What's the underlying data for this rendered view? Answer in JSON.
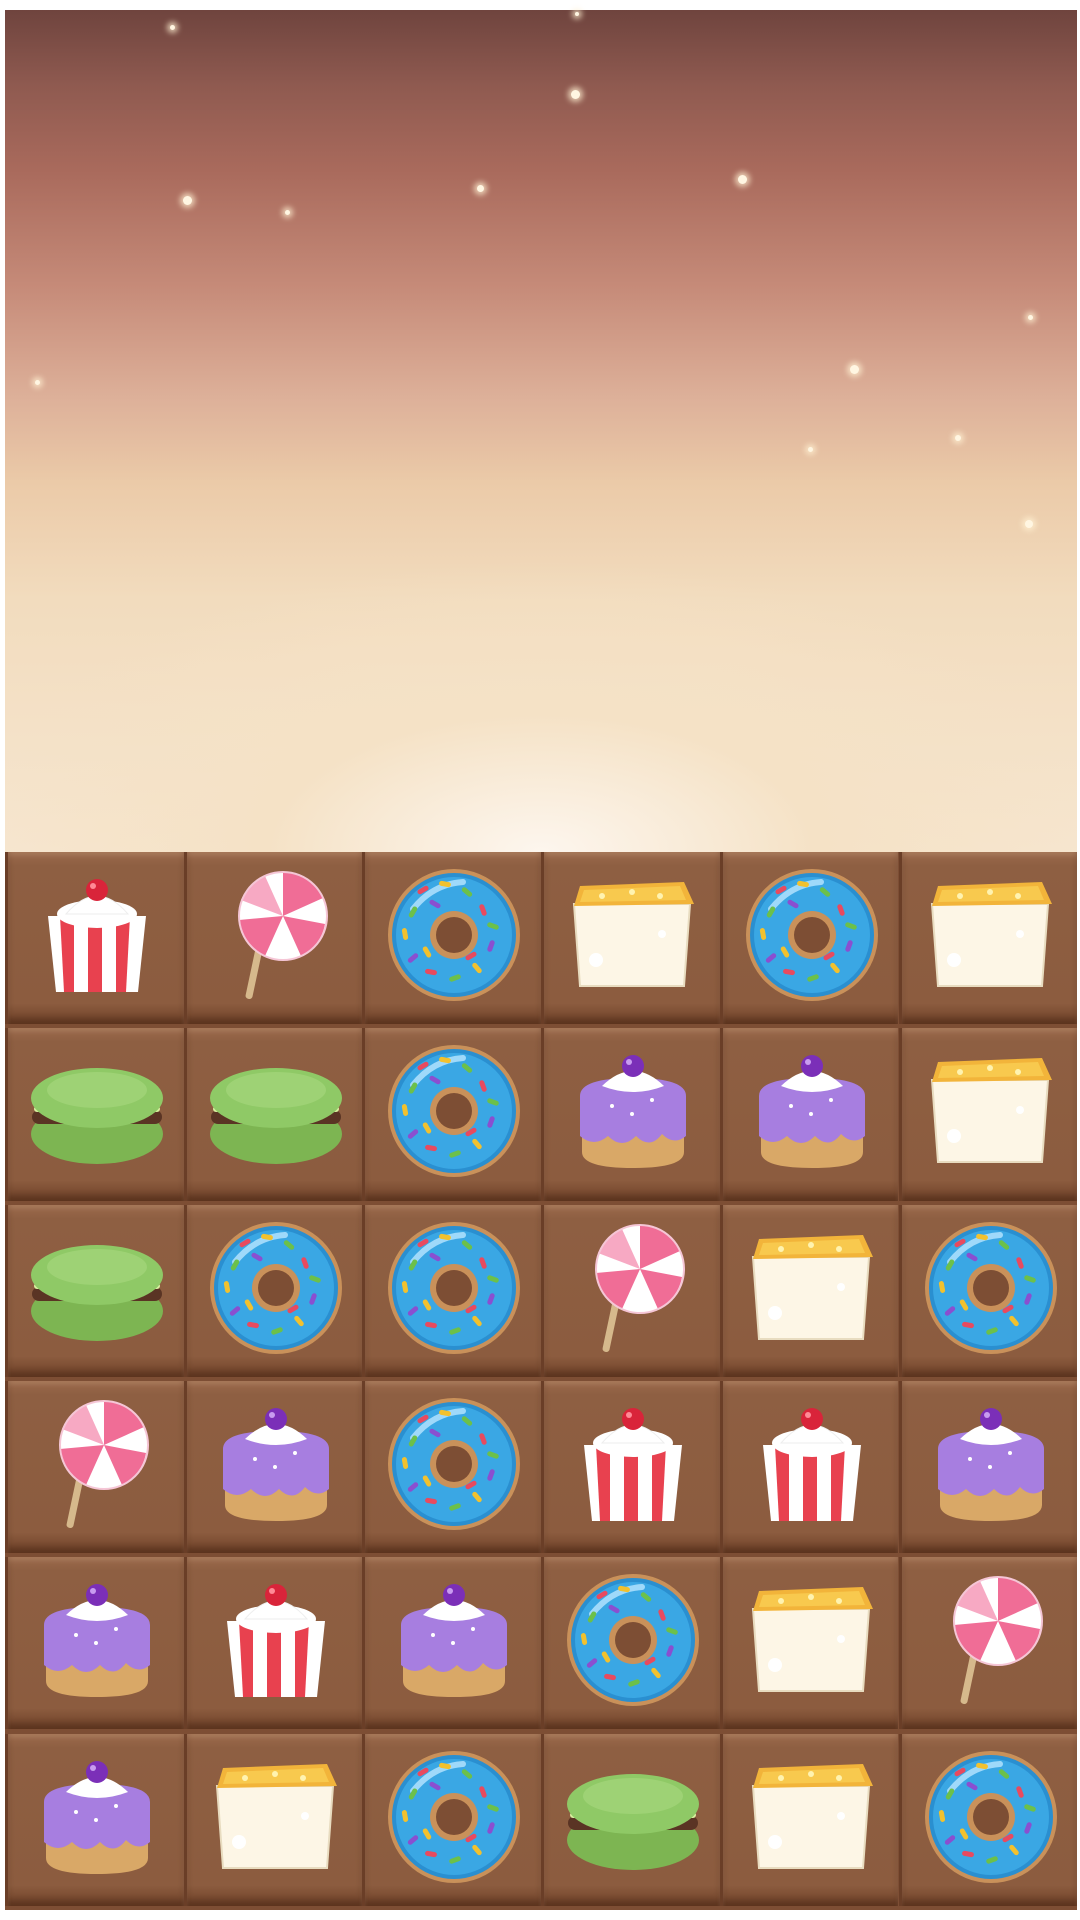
{
  "game": {
    "title": "",
    "colors": {
      "sky_top": "#6f443e",
      "sky_bottom": "#f6e6d0",
      "board": "#8c5c3f",
      "donut_icing": "#3aa7e4",
      "macaron": "#8fc966",
      "cupcake_icing": "#a77ee0",
      "popcorn_stripe": "#e8414f",
      "lollipop": "#f06d96",
      "cake_top": "#f2b43a"
    },
    "board": {
      "rows": 6,
      "cols": 6,
      "grid": [
        [
          "popcorn-cup",
          "lollipop",
          "blue-donut",
          "lemon-cake",
          "blue-donut",
          "lemon-cake"
        ],
        [
          "green-macaron",
          "green-macaron",
          "blue-donut",
          "purple-cupcake",
          "purple-cupcake",
          "lemon-cake"
        ],
        [
          "green-macaron",
          "blue-donut",
          "blue-donut",
          "lollipop",
          "lemon-cake",
          "blue-donut"
        ],
        [
          "lollipop",
          "purple-cupcake",
          "blue-donut",
          "popcorn-cup",
          "popcorn-cup",
          "purple-cupcake"
        ],
        [
          "purple-cupcake",
          "popcorn-cup",
          "purple-cupcake",
          "blue-donut",
          "lemon-cake",
          "lollipop"
        ],
        [
          "purple-cupcake",
          "lemon-cake",
          "blue-donut",
          "green-macaron",
          "lemon-cake",
          "blue-donut"
        ]
      ]
    }
  }
}
